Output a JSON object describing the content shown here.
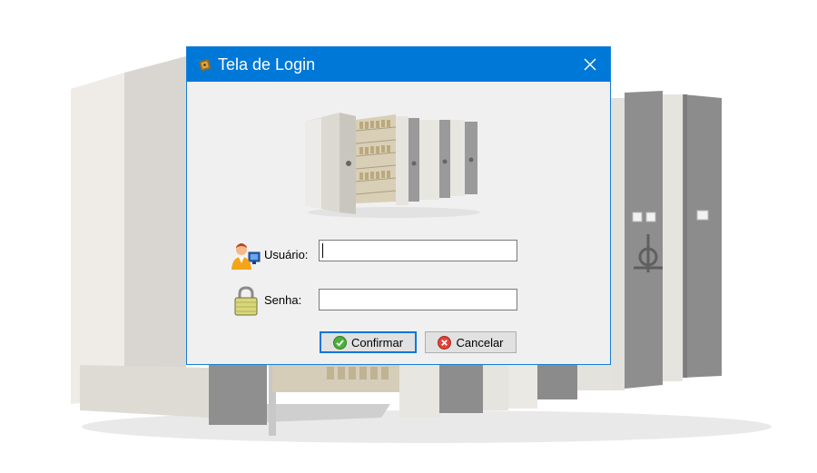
{
  "window": {
    "title": "Tela de Login",
    "title_icon": "padlock-icon",
    "close_icon": "close-icon"
  },
  "form": {
    "user_label": "Usuário:",
    "user_value": "",
    "password_label": "Senha:",
    "password_value": ""
  },
  "buttons": {
    "confirm_label": "Confirmar",
    "confirm_icon": "check-circle-icon",
    "cancel_label": "Cancelar",
    "cancel_icon": "x-circle-icon"
  },
  "colors": {
    "titlebar": "#0078d7",
    "dialog_bg": "#f0f0f0",
    "button_bg": "#e1e1e1"
  }
}
